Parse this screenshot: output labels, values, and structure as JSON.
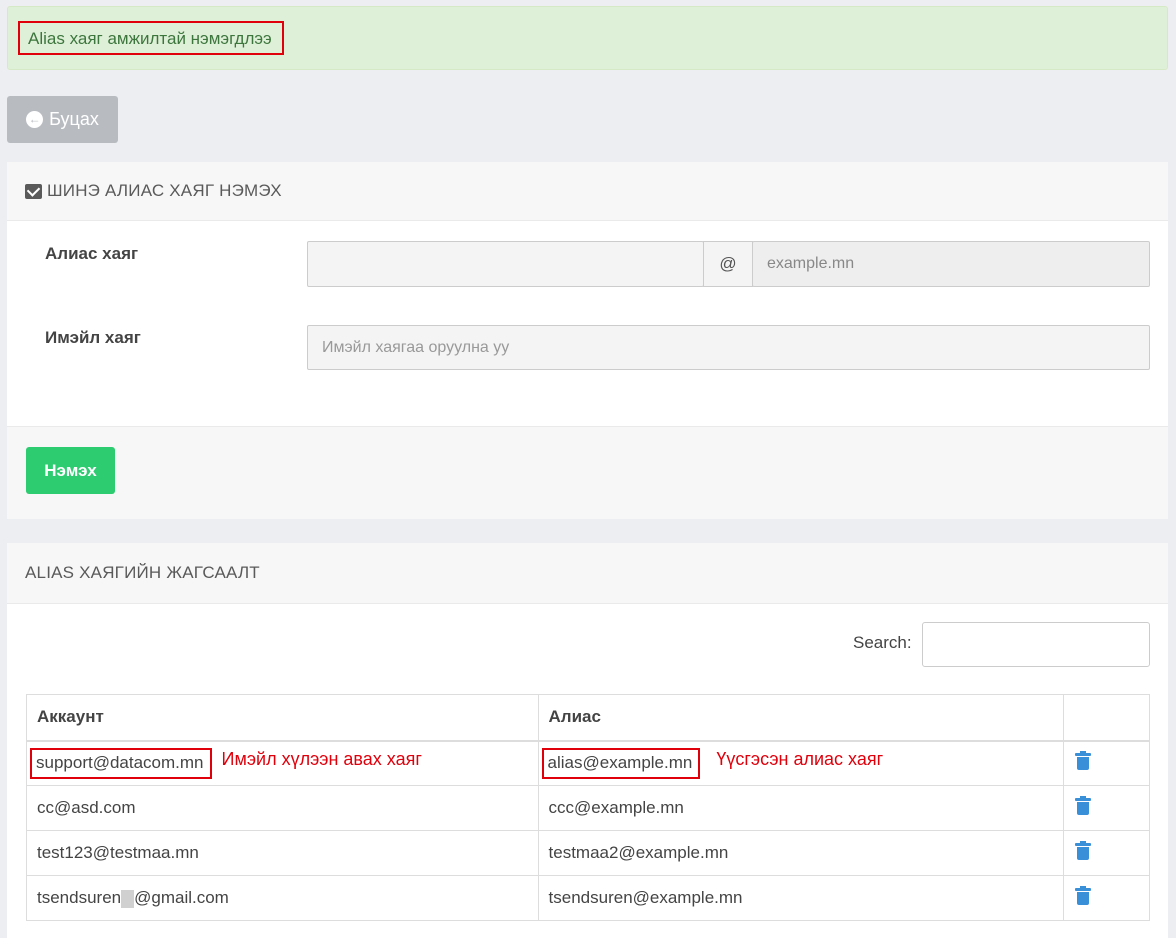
{
  "alert": {
    "message": "Alias хаяг амжилтай нэмэгдлээ"
  },
  "back_button": {
    "label": "Буцах",
    "icon": "arrow-circle-left-icon"
  },
  "add_panel": {
    "title": "ШИНЭ АЛИАС ХАЯГ НЭМЭХ",
    "icon": "envelope-icon",
    "alias_label": "Алиас хаяг",
    "alias_value": "",
    "at_symbol": "@",
    "domain_value": "example.mn",
    "email_label": "Имэйл хаяг",
    "email_placeholder": "Имэйл хаягаа оруулна уу",
    "submit_label": "Нэмэх"
  },
  "list_panel": {
    "title": "ALIAS ХАЯГИЙН ЖАГСААЛТ",
    "search_label": "Search:",
    "search_value": "",
    "columns": [
      "Аккаунт",
      "Алиас",
      ""
    ],
    "rows": [
      {
        "account": "support@datacom.mn",
        "alias": "alias@example.mn"
      },
      {
        "account": "cc@asd.com",
        "alias": "ccc@example.mn"
      },
      {
        "account": "test123@testmaa.mn",
        "alias": "testmaa2@example.mn"
      },
      {
        "account_prefix": "tsendsuren",
        "account_suffix": "@gmail.com",
        "alias": "tsendsuren@example.mn"
      }
    ],
    "delete_icon": "trash-icon"
  },
  "annotations": {
    "account_note": "Имэйл хүлээн авах хаяг",
    "alias_note": "Үүсгэсэн алиас хаяг"
  },
  "colors": {
    "alert_bg": "#dff0d8",
    "highlight": "#e0000c",
    "add_button": "#2ecc71",
    "back_button": "#b8bcc1",
    "trash_icon": "#3a8fd9"
  }
}
